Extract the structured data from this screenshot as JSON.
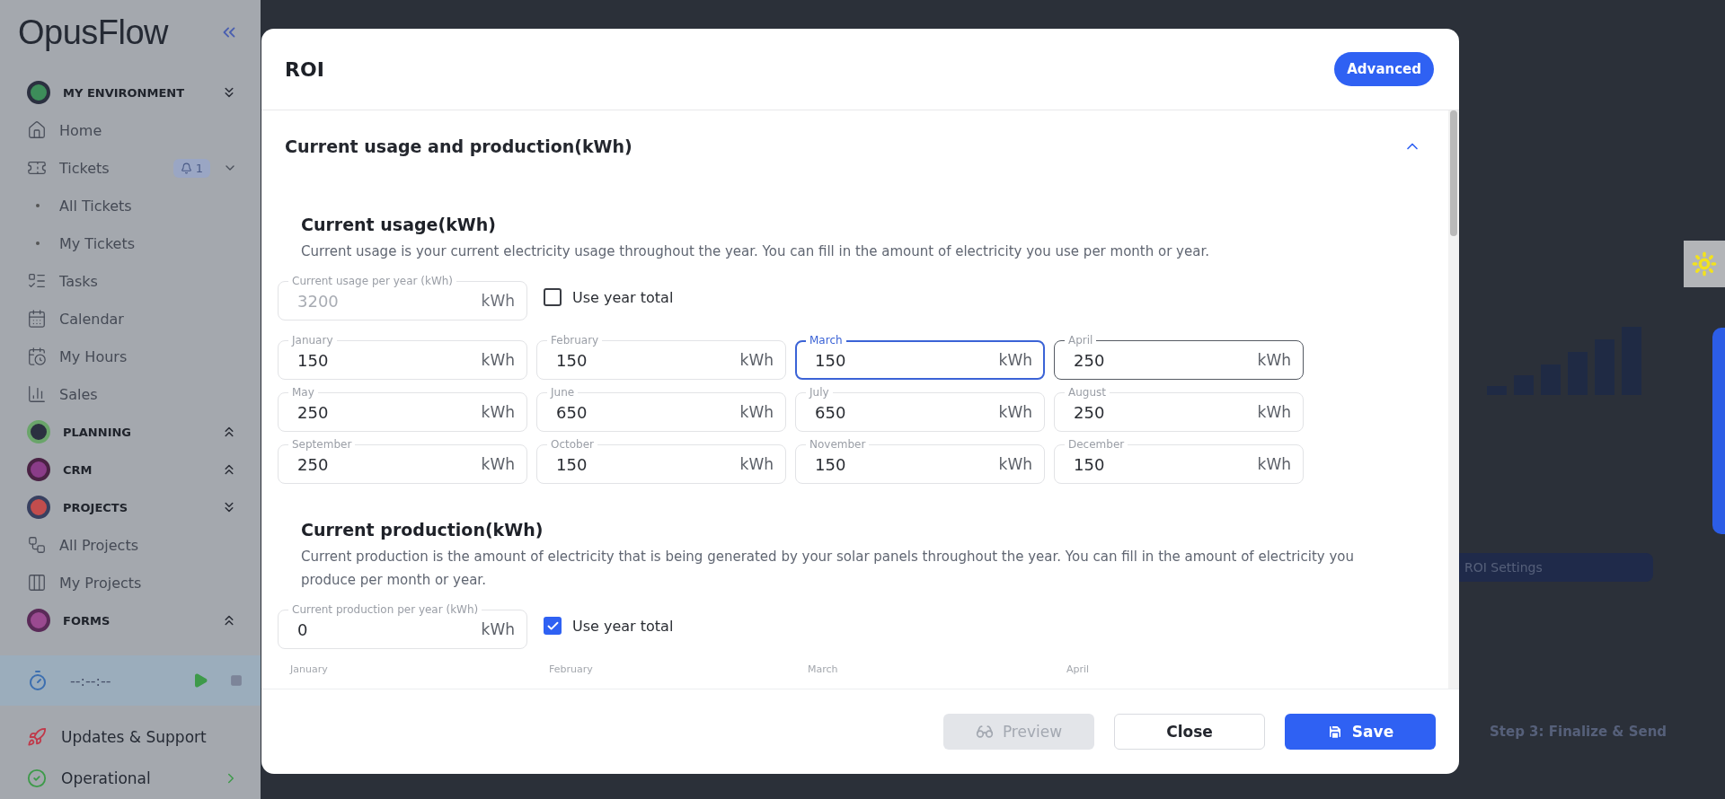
{
  "sidebar": {
    "logo": "OpusFlow",
    "items": [
      {
        "kind": "group",
        "label": "MY ENVIRONMENT",
        "expanded": true
      },
      {
        "kind": "item",
        "label": "Home"
      },
      {
        "kind": "item",
        "label": "Tickets",
        "badge": "1"
      },
      {
        "kind": "subitem",
        "label": "All Tickets"
      },
      {
        "kind": "subitem",
        "label": "My Tickets"
      },
      {
        "kind": "item",
        "label": "Tasks"
      },
      {
        "kind": "item",
        "label": "Calendar"
      },
      {
        "kind": "item",
        "label": "My Hours"
      },
      {
        "kind": "item",
        "label": "Sales"
      },
      {
        "kind": "group",
        "label": "PLANNING",
        "expanded": false
      },
      {
        "kind": "group",
        "label": "CRM",
        "expanded": false
      },
      {
        "kind": "group",
        "label": "PROJECTS",
        "expanded": true
      },
      {
        "kind": "item",
        "label": "All Projects"
      },
      {
        "kind": "item",
        "label": "My Projects"
      },
      {
        "kind": "group",
        "label": "FORMS",
        "expanded": false
      }
    ],
    "timer": "--:--:--",
    "footer": [
      "Updates & Support",
      "Operational"
    ]
  },
  "background": {
    "settings_button": "ROI Settings",
    "step_link": "Step 3: Finalize & Send"
  },
  "modal": {
    "title": "ROI",
    "advanced_button": "Advanced",
    "section": {
      "title": "Current usage and production(kWh)",
      "expanded": true
    },
    "usage": {
      "title": "Current usage(kWh)",
      "description": "Current usage is your current electricity usage throughout the year. You can fill in the amount of electricity you use per month or year.",
      "year_field": {
        "label": "Current usage per year (kWh)",
        "value": "3200",
        "unit": "kWh",
        "disabled": true
      },
      "use_year_total": {
        "label": "Use year total",
        "checked": false
      },
      "months": [
        {
          "label": "January",
          "value": "150",
          "unit": "kWh",
          "focused": false,
          "hovered": false
        },
        {
          "label": "February",
          "value": "150",
          "unit": "kWh",
          "focused": false,
          "hovered": false
        },
        {
          "label": "March",
          "value": "150",
          "unit": "kWh",
          "focused": true,
          "hovered": false
        },
        {
          "label": "April",
          "value": "250",
          "unit": "kWh",
          "focused": false,
          "hovered": true
        },
        {
          "label": "May",
          "value": "250",
          "unit": "kWh",
          "focused": false,
          "hovered": false
        },
        {
          "label": "June",
          "value": "650",
          "unit": "kWh",
          "focused": false,
          "hovered": false
        },
        {
          "label": "July",
          "value": "650",
          "unit": "kWh",
          "focused": false,
          "hovered": false
        },
        {
          "label": "August",
          "value": "250",
          "unit": "kWh",
          "focused": false,
          "hovered": false
        },
        {
          "label": "September",
          "value": "250",
          "unit": "kWh",
          "focused": false,
          "hovered": false
        },
        {
          "label": "October",
          "value": "150",
          "unit": "kWh",
          "focused": false,
          "hovered": false
        },
        {
          "label": "November",
          "value": "150",
          "unit": "kWh",
          "focused": false,
          "hovered": false
        },
        {
          "label": "December",
          "value": "150",
          "unit": "kWh",
          "focused": false,
          "hovered": false
        }
      ]
    },
    "production": {
      "title": "Current production(kWh)",
      "description": "Current production is the amount of electricity that is being generated by your solar panels throughout the year. You can fill in the amount of electricity you produce per month or year.",
      "year_field": {
        "label": "Current production per year (kWh)",
        "value": "0",
        "unit": "kWh",
        "disabled": false
      },
      "use_year_total": {
        "label": "Use year total",
        "checked": true
      },
      "month_labels": [
        "January",
        "February",
        "March",
        "April"
      ]
    },
    "buttons": [
      {
        "kind": "preview",
        "label": "Preview",
        "disabled": true
      },
      {
        "kind": "close",
        "label": "Close",
        "disabled": false
      },
      {
        "kind": "save",
        "label": "Save",
        "disabled": false
      }
    ]
  }
}
